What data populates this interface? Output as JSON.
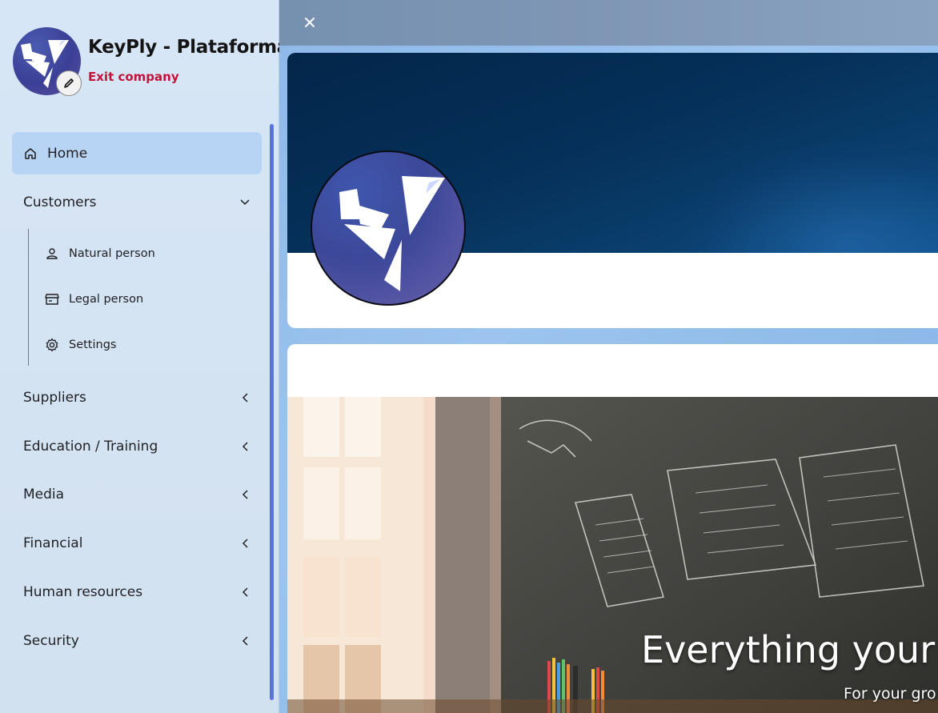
{
  "brand": {
    "title": "KeyPly - Plataforma",
    "exit_label": "Exit company",
    "logo_icon": "origami-bird-logo",
    "edit_icon": "pencil-icon",
    "exit_color": "#c4123a"
  },
  "nav": {
    "items": [
      {
        "label": "Home",
        "icon": "home-icon",
        "active": true
      },
      {
        "label": "Customers",
        "expanded": true
      },
      {
        "label": "Suppliers",
        "expanded": false
      },
      {
        "label": "Education / Training",
        "expanded": false
      },
      {
        "label": "Media",
        "expanded": false
      },
      {
        "label": "Financial",
        "expanded": false
      },
      {
        "label": "Human resources",
        "expanded": false
      },
      {
        "label": "Security",
        "expanded": false
      }
    ],
    "customers_sub": [
      {
        "label": "Natural person",
        "icon": "person-icon"
      },
      {
        "label": "Legal person",
        "icon": "store-icon"
      },
      {
        "label": "Settings",
        "icon": "gear-icon"
      }
    ],
    "active_color": "#b8d4f4",
    "scrollbar_color": "#5a72e0"
  },
  "main": {
    "close_icon": "close-icon",
    "banner": {
      "headline": "Everything your s",
      "subline": "For your gro"
    }
  }
}
